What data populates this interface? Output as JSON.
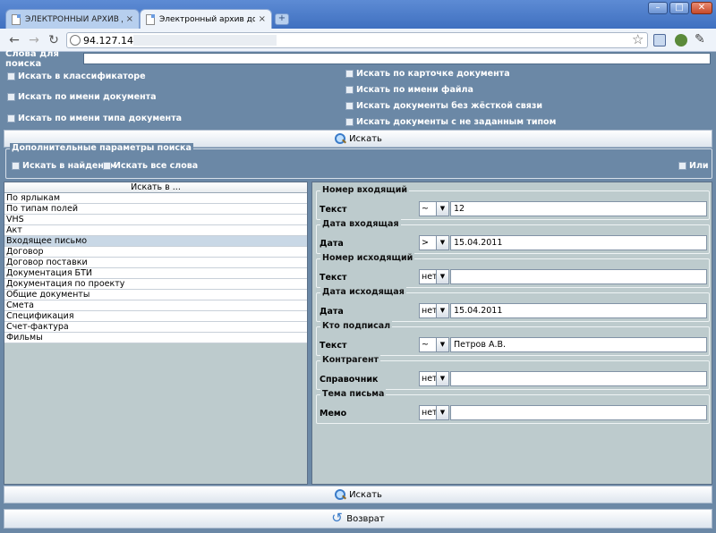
{
  "browser": {
    "tabs": [
      {
        "title": "ЭЛЕКТРОННЫЙ АРХИВ ДО...",
        "active": false
      },
      {
        "title": "Электронный архив доку...",
        "active": true
      }
    ],
    "url": "94.127.144"
  },
  "search": {
    "label": "Слова для поиска",
    "value": ""
  },
  "options_left": [
    "Искать в классификаторе",
    "Искать по имени документа",
    "Искать по имени типа документа"
  ],
  "options_right": [
    "Искать по карточке документа",
    "Искать по имени файла",
    "Искать документы без жёсткой связи",
    "Искать документы с не заданным типом"
  ],
  "search_button": "Искать",
  "extra_params": {
    "legend": "Дополнительные параметры поиска",
    "in_found": "Искать в найденом",
    "all_words": "Искать все слова",
    "or": "Или"
  },
  "list": {
    "header": "Искать в ...",
    "items": [
      "По ярлыкам",
      "По типам полей",
      "VHS",
      "Акт",
      "Входящее письмо",
      "Договор",
      "Договор поставки",
      "Документация БТИ",
      "Документация по проекту",
      "Общие документы",
      "Смета",
      "Спецификация",
      "Счет-фактура",
      "Фильмы"
    ],
    "selected": "Входящее письмо"
  },
  "params": [
    {
      "title": "Номер входящий",
      "field": "Текст",
      "op": "~",
      "value": "12"
    },
    {
      "title": "Дата входящая",
      "field": "Дата",
      "op": ">",
      "value": "15.04.2011"
    },
    {
      "title": "Номер исходящий",
      "field": "Текст",
      "op": "нет",
      "value": ""
    },
    {
      "title": "Дата исходящая",
      "field": "Дата",
      "op": "нет",
      "value": "15.04.2011"
    },
    {
      "title": "Кто подписал",
      "field": "Текст",
      "op": "~",
      "value": "Петров А.В."
    },
    {
      "title": "Контрагент",
      "field": "Справочник",
      "op": "нет",
      "value": ""
    },
    {
      "title": "Тема письма",
      "field": "Мемо",
      "op": "нет",
      "value": ""
    }
  ],
  "bottom_search_button": "Искать",
  "back_button": "Возврат"
}
